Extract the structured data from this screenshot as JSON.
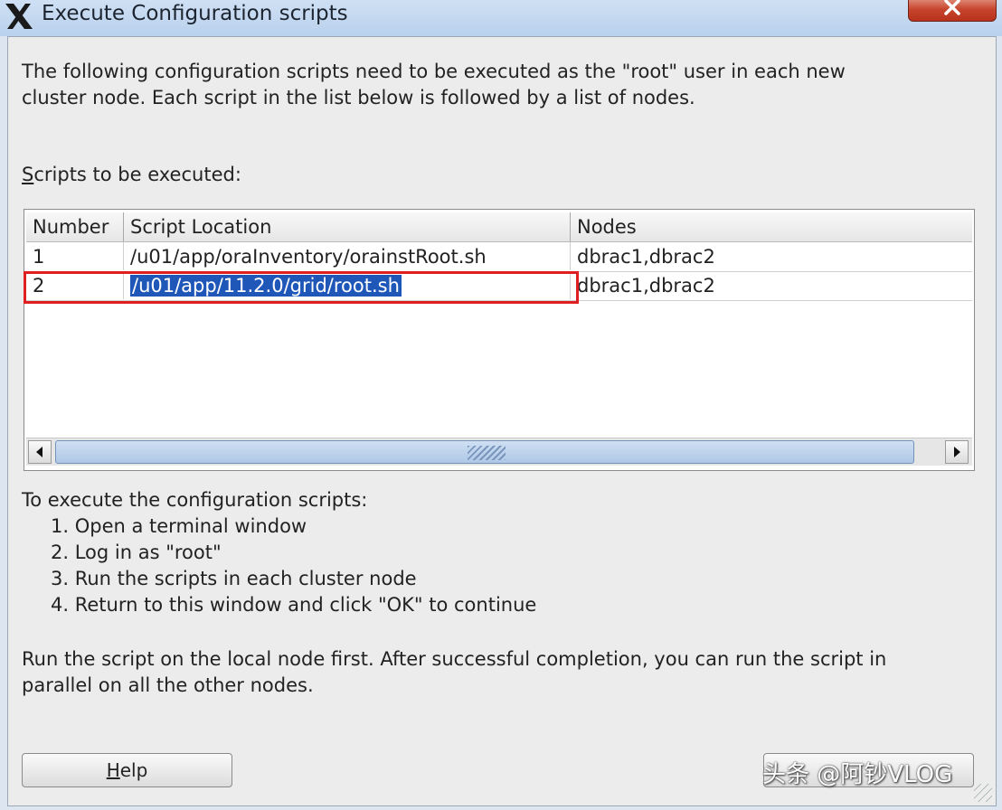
{
  "window": {
    "title": "Execute Configuration scripts"
  },
  "intro": {
    "line1": "The following configuration scripts need to be executed as the \"root\" user in each new",
    "line2": "cluster node. Each script in the list below is followed by a list of nodes."
  },
  "scripts_label": {
    "mnemonic": "S",
    "rest": "cripts to be executed:"
  },
  "table": {
    "columns": [
      "Number",
      "Script Location",
      "Nodes"
    ],
    "rows": [
      {
        "number": "1",
        "location": "/u01/app/oraInventory/orainstRoot.sh",
        "nodes": "dbrac1,dbrac2"
      },
      {
        "number": "2",
        "location": "/u01/app/11.2.0/grid/root.sh",
        "nodes": "dbrac1,dbrac2"
      }
    ],
    "selected_row": 2
  },
  "instructions": {
    "heading": "To execute the configuration scripts:",
    "steps": [
      "1. Open a terminal window",
      "2. Log in as \"root\"",
      "3. Run the scripts in each cluster node",
      "4. Return to this window and click \"OK\" to continue"
    ]
  },
  "footer_note": {
    "line1": "Run the script on the local node first. After successful completion, you can run the script in",
    "line2": "parallel on all the other nodes."
  },
  "buttons": {
    "help_mnemonic": "H",
    "help_rest": "elp"
  },
  "watermark": "头条 @阿钞VLOG",
  "colors": {
    "selection": "#1f57b8",
    "highlight_box": "#e02020",
    "close_button": "#c7442c"
  }
}
